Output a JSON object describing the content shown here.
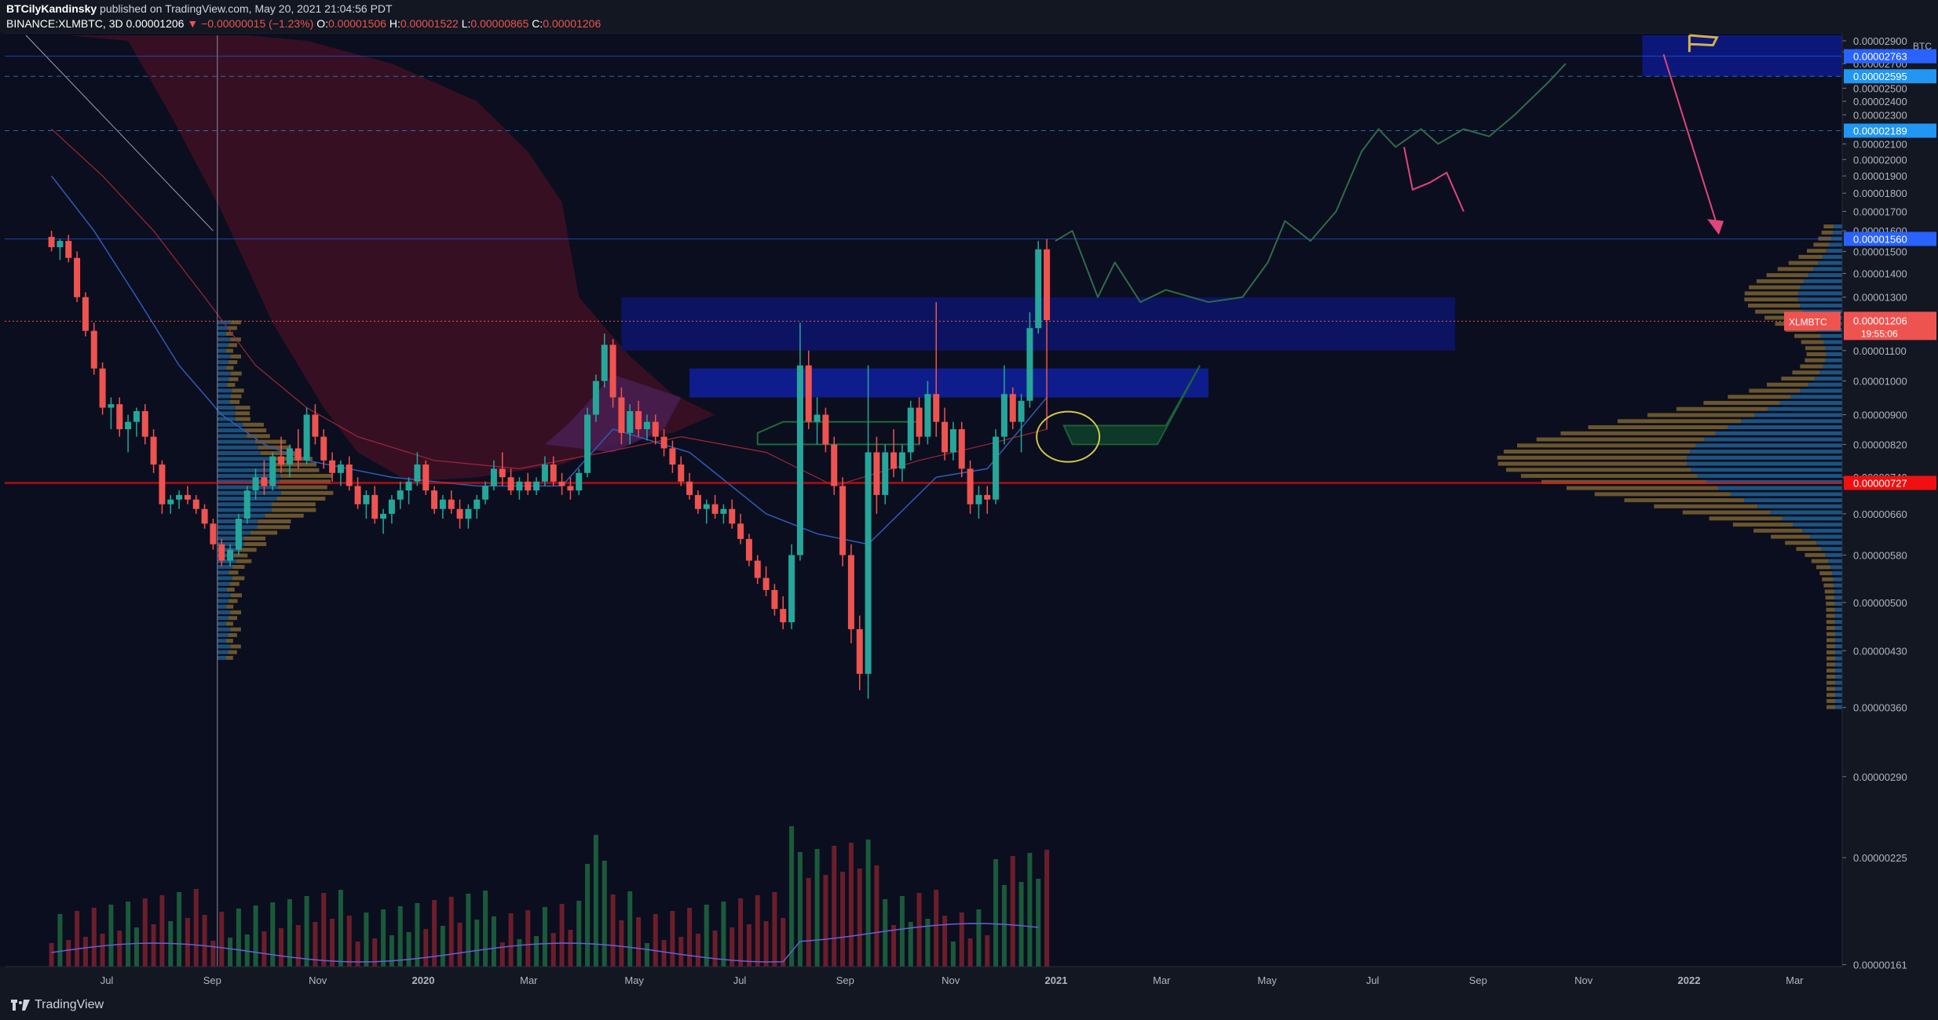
{
  "header": {
    "author": "BTCilyKandinsky",
    "published": "published on TradingView.com, May 20, 2021 21:04:56 PDT",
    "symbol": "BINANCE:XLMBTC, 3D",
    "last": "0.00001206",
    "change": "▼ −0.00000015 (−1.23%)",
    "ohlc": {
      "o": "0.00001506",
      "h": "0.00001522",
      "l": "0.00000865",
      "c": "0.00001206"
    }
  },
  "footer": {
    "brand": "TradingView"
  },
  "colors": {
    "up": "#26a69a",
    "down": "#ef5350",
    "bg": "#0b0e1e",
    "cloud": "#3a1024",
    "zone": "#0d1a8a",
    "path": "#2f6b4a"
  },
  "chart_data": {
    "type": "candlestick",
    "unit": "BTC",
    "x_ticks": [
      "Jul",
      "Sep",
      "Nov",
      "2020",
      "Mar",
      "May",
      "Jul",
      "Sep",
      "Nov",
      "2021",
      "Mar",
      "May",
      "Jul",
      "Sep",
      "Nov",
      "2022",
      "Mar",
      "Ma"
    ],
    "y_ticks": [
      "0.00002900",
      "0.00002800",
      "0.00002700",
      "0.00002500",
      "0.00002400",
      "0.00002300",
      "0.00002100",
      "0.00002000",
      "0.00001900",
      "0.00001800",
      "0.00001700",
      "0.00001600",
      "0.00001500",
      "0.00001400",
      "0.00001300",
      "0.00001100",
      "0.00001000",
      "0.00000900",
      "0.00000820",
      "0.00000740",
      "0.00000660",
      "0.00000580",
      "0.00000500",
      "0.00000430",
      "0.00000360",
      "0.00000290",
      "0.00000225",
      "0.00000161"
    ],
    "y_scale": "log",
    "y_range": [
      1.6e-06,
      2.95e-05
    ],
    "current_price": {
      "label": "XLMBTC",
      "value": "0.00001206",
      "countdown": "19:55:06"
    },
    "levels": [
      {
        "value": "0.00002763",
        "color": "#2962ff",
        "style": "solid"
      },
      {
        "value": "0.00002595",
        "color": "#2196f3",
        "style": "dashed"
      },
      {
        "value": "0.00002189",
        "color": "#2196f3",
        "style": "dashed"
      },
      {
        "value": "0.00001560",
        "color": "#2962ff",
        "style": "solid"
      },
      {
        "value": "0.00000727",
        "color": "#f01010",
        "style": "solid"
      }
    ],
    "candles_ohlc_note": "sampled 3D candles (months from Jun 2019)",
    "candles": [
      [
        0.0,
        1.57e-05,
        1.6e-05,
        1.5e-05,
        1.52e-05
      ],
      [
        0.1,
        1.52e-05,
        1.56e-05,
        1.46e-05,
        1.55e-05
      ],
      [
        0.2,
        1.55e-05,
        1.58e-05,
        1.45e-05,
        1.47e-05
      ],
      [
        0.3,
        1.47e-05,
        1.5e-05,
        1.28e-05,
        1.3e-05
      ],
      [
        0.4,
        1.3e-05,
        1.32e-05,
        1.15e-05,
        1.17e-05
      ],
      [
        0.5,
        1.17e-05,
        1.2e-05,
        1.02e-05,
        1.04e-05
      ],
      [
        0.6,
        1.04e-05,
        1.06e-05,
        9e-06,
        9.2e-06
      ],
      [
        0.7,
        9.2e-06,
        9.5e-06,
        8.6e-06,
        9.3e-06
      ],
      [
        0.8,
        9.3e-06,
        9.5e-06,
        8.4e-06,
        8.6e-06
      ],
      [
        0.9,
        8.6e-06,
        9e-06,
        8e-06,
        8.8e-06
      ],
      [
        1.0,
        8.8e-06,
        9.2e-06,
        8.4e-06,
        9.1e-06
      ],
      [
        1.1,
        9.1e-06,
        9.3e-06,
        8.2e-06,
        8.4e-06
      ],
      [
        1.2,
        8.4e-06,
        8.6e-06,
        7.5e-06,
        7.7e-06
      ],
      [
        1.3,
        7.7e-06,
        7.8e-06,
        6.6e-06,
        6.8e-06
      ],
      [
        1.4,
        6.8e-06,
        7e-06,
        6.6e-06,
        6.9e-06
      ],
      [
        1.5,
        6.9e-06,
        7.1e-06,
        6.7e-06,
        7e-06
      ],
      [
        1.6,
        7e-06,
        7.2e-06,
        6.8e-06,
        6.9e-06
      ],
      [
        1.7,
        6.9e-06,
        7e-06,
        6.6e-06,
        6.7e-06
      ],
      [
        1.8,
        6.7e-06,
        6.8e-06,
        6.3e-06,
        6.4e-06
      ],
      [
        1.9,
        6.4e-06,
        6.5e-06,
        5.9e-06,
        6e-06
      ],
      [
        2.0,
        6e-06,
        6.1e-06,
        5.6e-06,
        5.7e-06
      ],
      [
        2.1,
        5.7e-06,
        6e-06,
        5.6e-06,
        5.9e-06
      ],
      [
        2.2,
        5.9e-06,
        6.6e-06,
        5.8e-06,
        6.5e-06
      ],
      [
        2.3,
        6.5e-06,
        7.2e-06,
        6.4e-06,
        7.1e-06
      ],
      [
        2.4,
        7.1e-06,
        7.6e-06,
        6.9e-06,
        7.4e-06
      ],
      [
        2.5,
        7.4e-06,
        7.8e-06,
        7e-06,
        7.2e-06
      ],
      [
        2.6,
        7.2e-06,
        8e-06,
        7.1e-06,
        7.9e-06
      ],
      [
        2.7,
        7.9e-06,
        8.4e-06,
        7.5e-06,
        7.7e-06
      ],
      [
        2.8,
        7.7e-06,
        8.2e-06,
        7.4e-06,
        8.1e-06
      ],
      [
        2.9,
        8.1e-06,
        8.6e-06,
        7.6e-06,
        7.8e-06
      ],
      [
        3.0,
        7.8e-06,
        9.2e-06,
        7.7e-06,
        9e-06
      ],
      [
        3.1,
        9e-06,
        9.3e-06,
        8.2e-06,
        8.4e-06
      ],
      [
        3.2,
        8.4e-06,
        8.6e-06,
        7.6e-06,
        7.8e-06
      ],
      [
        3.3,
        7.8e-06,
        8e-06,
        7.3e-06,
        7.5e-06
      ],
      [
        3.4,
        7.5e-06,
        7.8e-06,
        7.2e-06,
        7.7e-06
      ],
      [
        3.5,
        7.7e-06,
        7.9e-06,
        7.1e-06,
        7.2e-06
      ],
      [
        3.6,
        7.2e-06,
        7.4e-06,
        6.7e-06,
        6.8e-06
      ],
      [
        3.7,
        6.8e-06,
        7.1e-06,
        6.5e-06,
        7e-06
      ],
      [
        3.8,
        7e-06,
        7.2e-06,
        6.4e-06,
        6.5e-06
      ],
      [
        3.9,
        6.5e-06,
        6.7e-06,
        6.2e-06,
        6.6e-06
      ],
      [
        4.0,
        6.6e-06,
        7e-06,
        6.4e-06,
        6.9e-06
      ],
      [
        4.1,
        6.9e-06,
        7.3e-06,
        6.7e-06,
        7.1e-06
      ],
      [
        4.2,
        7.1e-06,
        7.4e-06,
        6.8e-06,
        7.3e-06
      ],
      [
        4.3,
        7.3e-06,
        8e-06,
        7.2e-06,
        7.7e-06
      ],
      [
        4.4,
        7.7e-06,
        7.8e-06,
        7e-06,
        7.1e-06
      ],
      [
        4.5,
        7.1e-06,
        7.2e-06,
        6.6e-06,
        6.7e-06
      ],
      [
        4.6,
        6.7e-06,
        7e-06,
        6.5e-06,
        6.9e-06
      ],
      [
        4.7,
        6.9e-06,
        7.1e-06,
        6.6e-06,
        6.7e-06
      ],
      [
        4.8,
        6.7e-06,
        6.9e-06,
        6.3e-06,
        6.5e-06
      ],
      [
        4.9,
        6.5e-06,
        6.8e-06,
        6.3e-06,
        6.7e-06
      ],
      [
        5.0,
        6.7e-06,
        7e-06,
        6.5e-06,
        6.9e-06
      ],
      [
        5.1,
        6.9e-06,
        7.3e-06,
        6.8e-06,
        7.2e-06
      ],
      [
        5.2,
        7.2e-06,
        7.8e-06,
        7.1e-06,
        7.6e-06
      ],
      [
        5.3,
        7.6e-06,
        8e-06,
        7.2e-06,
        7.4e-06
      ],
      [
        5.4,
        7.4e-06,
        7.6e-06,
        7e-06,
        7.1e-06
      ],
      [
        5.5,
        7.1e-06,
        7.4e-06,
        6.9e-06,
        7.3e-06
      ],
      [
        5.6,
        7.3e-06,
        7.5e-06,
        7e-06,
        7.1e-06
      ],
      [
        5.7,
        7.1e-06,
        7.4e-06,
        7e-06,
        7.3e-06
      ],
      [
        5.8,
        7.3e-06,
        7.9e-06,
        7.2e-06,
        7.7e-06
      ],
      [
        5.9,
        7.7e-06,
        7.9e-06,
        7.2e-06,
        7.3e-06
      ],
      [
        6.0,
        7.3e-06,
        7.5e-06,
        7e-06,
        7.2e-06
      ],
      [
        6.1,
        7.2e-06,
        7.4e-06,
        6.9e-06,
        7.1e-06
      ],
      [
        6.2,
        7.1e-06,
        7.6e-06,
        7e-06,
        7.5e-06
      ],
      [
        6.3,
        7.5e-06,
        9.2e-06,
        7.4e-06,
        9e-06
      ],
      [
        6.4,
        9e-06,
        1.02e-05,
        8.8e-06,
        1e-05
      ],
      [
        6.5,
        1e-05,
        1.16e-05,
        9.8e-06,
        1.12e-05
      ],
      [
        6.6,
        1.12e-05,
        1.14e-05,
        9.2e-06,
        9.5e-06
      ],
      [
        6.7,
        9.5e-06,
        9.8e-06,
        8.2e-06,
        8.5e-06
      ],
      [
        6.8,
        8.5e-06,
        9.3e-06,
        8.2e-06,
        9.1e-06
      ],
      [
        6.9,
        9.1e-06,
        9.4e-06,
        8.4e-06,
        8.6e-06
      ],
      [
        7.0,
        8.6e-06,
        9e-06,
        8.3e-06,
        8.8e-06
      ],
      [
        7.1,
        8.8e-06,
        9e-06,
        8.2e-06,
        8.4e-06
      ],
      [
        7.2,
        8.4e-06,
        8.6e-06,
        7.9e-06,
        8.1e-06
      ],
      [
        7.3,
        8.1e-06,
        8.3e-06,
        7.5e-06,
        7.7e-06
      ],
      [
        7.4,
        7.7e-06,
        7.9e-06,
        7.2e-06,
        7.3e-06
      ],
      [
        7.5,
        7.3e-06,
        7.5e-06,
        6.9e-06,
        7e-06
      ],
      [
        7.6,
        7e-06,
        7.1e-06,
        6.6e-06,
        6.7e-06
      ],
      [
        7.7,
        6.7e-06,
        6.9e-06,
        6.4e-06,
        6.8e-06
      ],
      [
        7.8,
        6.8e-06,
        7e-06,
        6.5e-06,
        6.6e-06
      ],
      [
        7.9,
        6.6e-06,
        6.8e-06,
        6.4e-06,
        6.7e-06
      ],
      [
        8.0,
        6.7e-06,
        6.9e-06,
        6.3e-06,
        6.4e-06
      ],
      [
        8.1,
        6.4e-06,
        6.6e-06,
        6e-06,
        6.1e-06
      ],
      [
        8.2,
        6.1e-06,
        6.2e-06,
        5.6e-06,
        5.7e-06
      ],
      [
        8.3,
        5.7e-06,
        5.8e-06,
        5.3e-06,
        5.4e-06
      ],
      [
        8.4,
        5.4e-06,
        5.6e-06,
        5.1e-06,
        5.2e-06
      ],
      [
        8.5,
        5.2e-06,
        5.3e-06,
        4.8e-06,
        4.9e-06
      ],
      [
        8.6,
        4.9e-06,
        5.1e-06,
        4.6e-06,
        4.7e-06
      ],
      [
        8.7,
        4.7e-06,
        6e-06,
        4.6e-06,
        5.8e-06
      ],
      [
        8.8,
        5.8e-06,
        1.2e-05,
        5.7e-06,
        1.05e-05
      ],
      [
        8.9,
        1.05e-05,
        1.1e-05,
        8.6e-06,
        8.8e-06
      ],
      [
        9.0,
        8.8e-06,
        9.5e-06,
        8.2e-06,
        9e-06
      ],
      [
        9.1,
        9e-06,
        9.2e-06,
        8e-06,
        8.2e-06
      ],
      [
        9.2,
        8.2e-06,
        8.4e-06,
        7e-06,
        7.2e-06
      ],
      [
        9.3,
        7.2e-06,
        7.4e-06,
        5.6e-06,
        5.8e-06
      ],
      [
        9.4,
        5.8e-06,
        6e-06,
        4.4e-06,
        4.6e-06
      ],
      [
        9.5,
        4.6e-06,
        4.8e-06,
        3.8e-06,
        4e-06
      ],
      [
        9.6,
        4e-06,
        1.05e-05,
        3.7e-06,
        8e-06
      ],
      [
        9.7,
        8e-06,
        8.4e-06,
        6.6e-06,
        7e-06
      ],
      [
        9.8,
        7e-06,
        8.2e-06,
        6.8e-06,
        8e-06
      ],
      [
        9.9,
        8e-06,
        8.6e-06,
        7.4e-06,
        7.6e-06
      ],
      [
        10.0,
        7.6e-06,
        8.2e-06,
        7.3e-06,
        8e-06
      ],
      [
        10.1,
        8e-06,
        9.4e-06,
        7.8e-06,
        9.2e-06
      ],
      [
        10.2,
        9.2e-06,
        9.5e-06,
        8.2e-06,
        8.4e-06
      ],
      [
        10.3,
        8.4e-06,
        1e-05,
        8.2e-06,
        9.6e-06
      ],
      [
        10.4,
        9.6e-06,
        1.28e-05,
        8.4e-06,
        8.8e-06
      ],
      [
        10.5,
        8.8e-06,
        9.2e-06,
        7.8e-06,
        8e-06
      ],
      [
        10.6,
        8e-06,
        8.8e-06,
        7.8e-06,
        8.6e-06
      ],
      [
        10.7,
        8.6e-06,
        8.8e-06,
        7.4e-06,
        7.6e-06
      ],
      [
        10.8,
        7.6e-06,
        7.8e-06,
        6.6e-06,
        6.8e-06
      ],
      [
        10.9,
        6.8e-06,
        7.2e-06,
        6.5e-06,
        7e-06
      ],
      [
        11.0,
        7e-06,
        7.2e-06,
        6.6e-06,
        6.9e-06
      ],
      [
        11.1,
        6.9e-06,
        8.6e-06,
        6.8e-06,
        8.4e-06
      ],
      [
        11.2,
        8.4e-06,
        1.05e-05,
        8.2e-06,
        9.6e-06
      ],
      [
        11.3,
        9.6e-06,
        9.8e-06,
        8.6e-06,
        8.8e-06
      ],
      [
        11.4,
        8.8e-06,
        9.6e-06,
        8e-06,
        9.4e-06
      ],
      [
        11.5,
        9.4e-06,
        1.24e-05,
        9.2e-06,
        1.18e-05
      ],
      [
        11.6,
        1.18e-05,
        1.55e-05,
        1.16e-05,
        1.51e-05
      ],
      [
        11.7,
        1.51e-05,
        1.56e-05,
        8.6e-06,
        1.21e-05
      ]
    ],
    "volume_note": "relative volume bars (0-1)",
    "annotations": [
      "projected green path",
      "target flag",
      "pink arrow",
      "ichimoku cloud",
      "volume profile"
    ]
  }
}
